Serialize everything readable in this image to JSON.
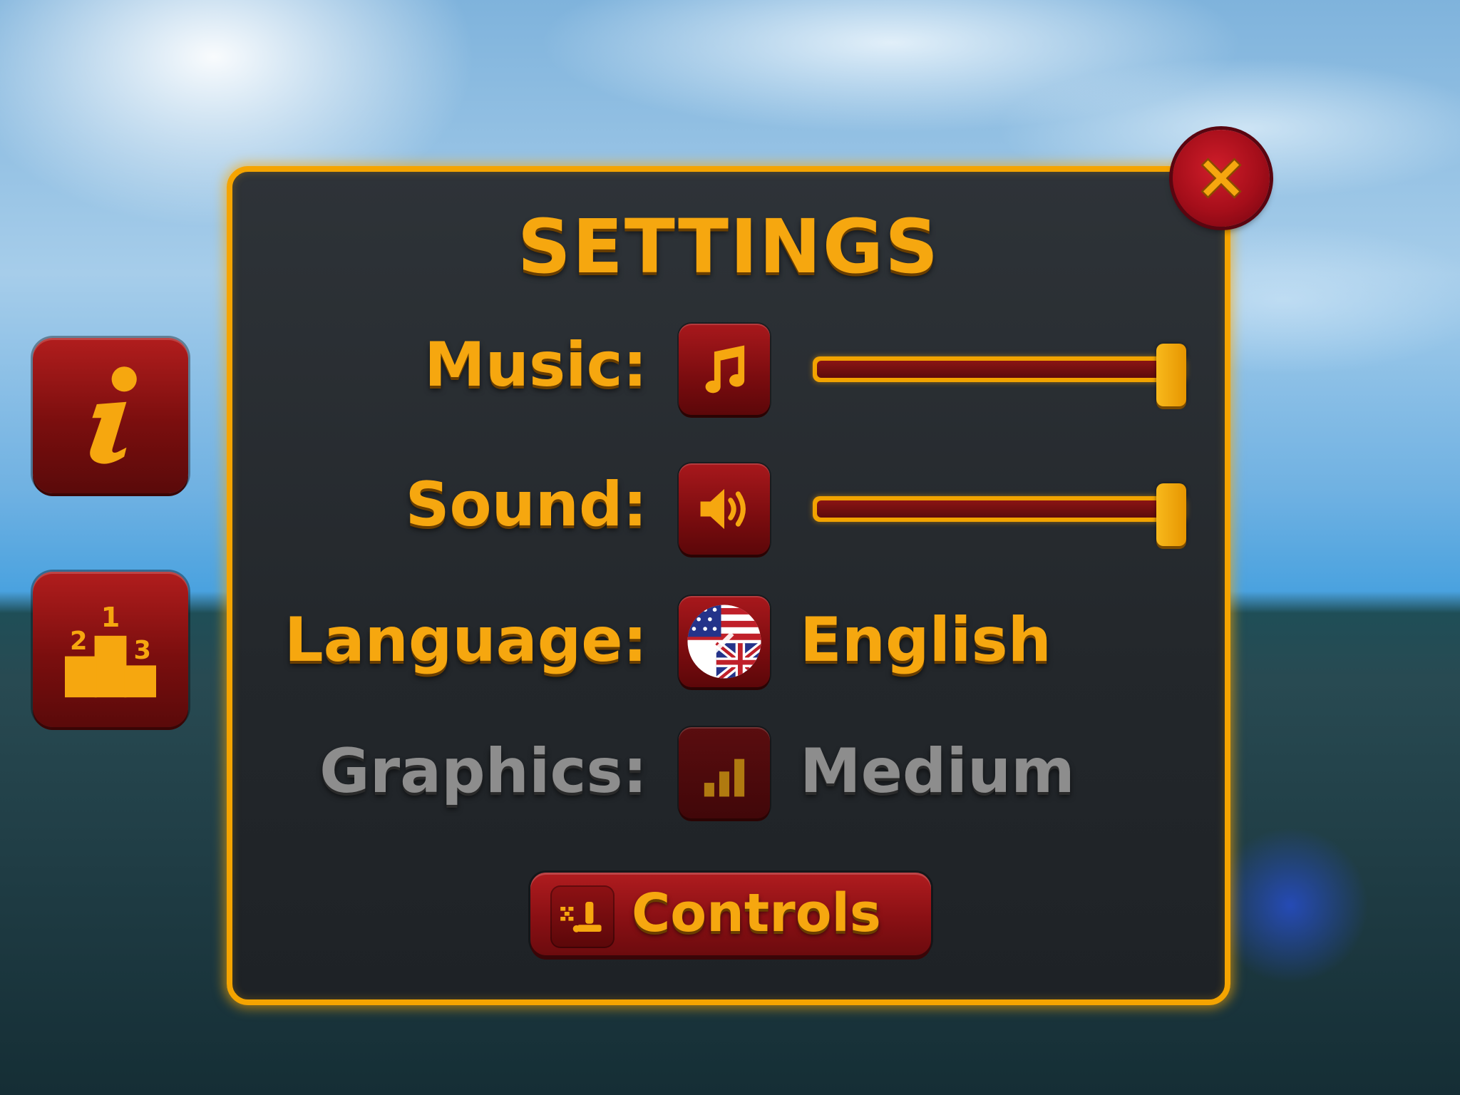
{
  "settings": {
    "title": "SETTINGS",
    "rows": [
      {
        "label": "Music:",
        "icon": "music-note-icon",
        "type": "slider",
        "level_percent": 100
      },
      {
        "label": "Sound:",
        "icon": "speaker-icon",
        "type": "slider",
        "level_percent": 100
      },
      {
        "label": "Language:",
        "icon": "flag-us-uk-icon",
        "type": "option",
        "value": "English"
      },
      {
        "label": "Graphics:",
        "icon": "signal-bars-icon",
        "type": "option",
        "value": "Medium",
        "disabled": true
      }
    ],
    "controls_button": {
      "label": "Controls",
      "icon": "joystick-icon"
    }
  },
  "side_buttons": [
    {
      "icon": "info-icon"
    },
    {
      "icon": "leaderboard-podium-icon"
    }
  ],
  "close_button": {
    "icon": "close-icon"
  },
  "colors": {
    "accent_gold": "#f6a70f",
    "button_red": "#8a1014",
    "panel_dark": "#23272b",
    "disabled_gray": "#8d8d8d"
  }
}
